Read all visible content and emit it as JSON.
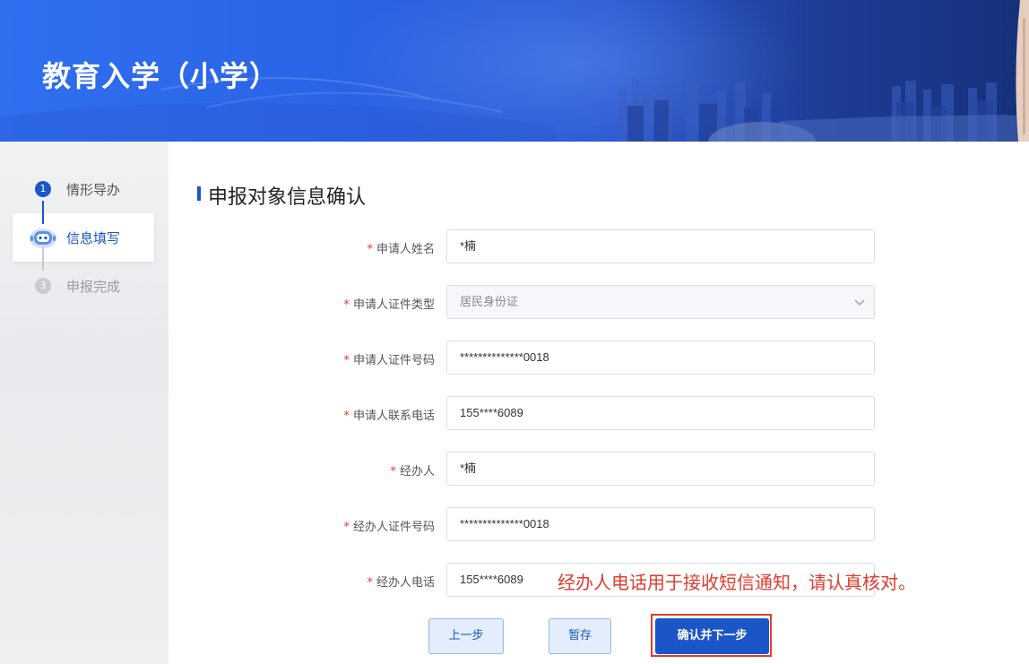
{
  "header": {
    "title": "教育入学（小学）"
  },
  "steps": [
    {
      "num": "1",
      "label": "情形导办"
    },
    {
      "num": "2",
      "label": "信息填写"
    },
    {
      "num": "3",
      "label": "申报完成"
    }
  ],
  "section": {
    "title": "申报对象信息确认"
  },
  "form": {
    "required_mark": "*",
    "fields": [
      {
        "label": "申请人姓名",
        "value": "*楠"
      },
      {
        "label": "申请人证件类型",
        "value": "居民身份证"
      },
      {
        "label": "申请人证件号码",
        "value": "**************0018"
      },
      {
        "label": "申请人联系电话",
        "value": "155****6089"
      },
      {
        "label": "经办人",
        "value": "*楠"
      },
      {
        "label": "经办人证件号码",
        "value": "**************0018"
      },
      {
        "label": "经办人电话",
        "value": "155****6089"
      }
    ],
    "note": "经办人电话用于接收短信通知，请认真核对。"
  },
  "buttons": {
    "prev": "上一步",
    "save": "暂存",
    "next": "确认并下一步"
  },
  "colors": {
    "primary": "#1a56c8",
    "danger": "#e23b2e",
    "banner": "#2f6ff0"
  },
  "icons": {
    "select_arrow": "chevron-down-icon",
    "step_current": "robot-icon"
  }
}
